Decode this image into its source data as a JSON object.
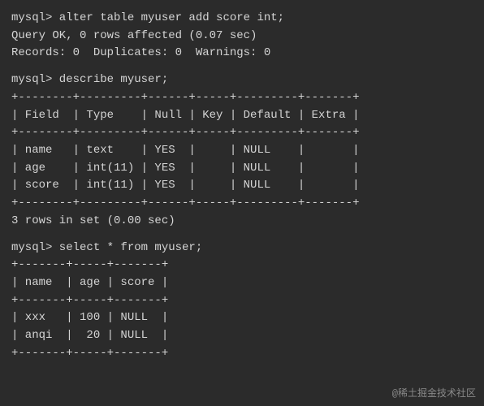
{
  "terminal": {
    "bg": "#2b2b2b",
    "lines": [
      {
        "type": "cmd",
        "content": "mysql> alter table myuser add score int;"
      },
      {
        "type": "output",
        "content": "Query OK, 0 rows affected (0.07 sec)"
      },
      {
        "type": "output",
        "content": "Records: 0  Duplicates: 0  Warnings: 0"
      },
      {
        "type": "blank",
        "content": ""
      },
      {
        "type": "cmd",
        "content": "mysql> describe myuser;"
      },
      {
        "type": "border",
        "content": "+--------+---------+------+-----+---------+-------+"
      },
      {
        "type": "header",
        "content": "| Field  | Type    | Null | Key | Default | Extra |"
      },
      {
        "type": "border",
        "content": "+--------+---------+------+-----+---------+-------+"
      },
      {
        "type": "row",
        "content": "| name   | text    | YES  |     | NULL    |       |"
      },
      {
        "type": "row",
        "content": "| age    | int(11) | YES  |     | NULL    |       |"
      },
      {
        "type": "row",
        "content": "| score  | int(11) | YES  |     | NULL    |       |"
      },
      {
        "type": "border",
        "content": "+--------+---------+------+-----+---------+-------+"
      },
      {
        "type": "output",
        "content": "3 rows in set (0.00 sec)"
      },
      {
        "type": "blank",
        "content": ""
      },
      {
        "type": "cmd",
        "content": "mysql> select * from myuser;"
      },
      {
        "type": "border",
        "content": "+-------+-----+-------+"
      },
      {
        "type": "header",
        "content": "| name  | age | score |"
      },
      {
        "type": "border",
        "content": "+-------+-----+-------+"
      },
      {
        "type": "row",
        "content": "| xxx   | 100 | NULL  |"
      },
      {
        "type": "row",
        "content": "| anqi  |  20 | NULL  |"
      },
      {
        "type": "border",
        "content": "+-------+-----+-------+"
      }
    ],
    "watermark": "@稀土掘金技术社区"
  }
}
